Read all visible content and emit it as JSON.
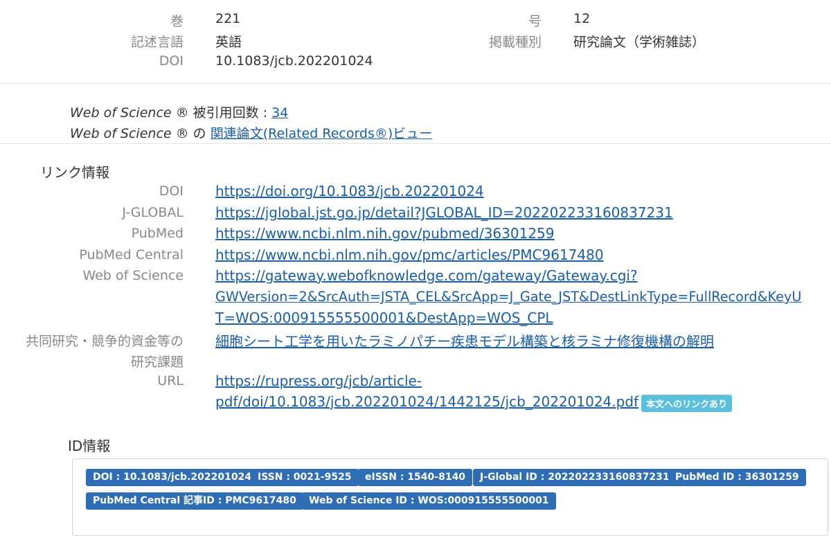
{
  "meta": {
    "volume_label": "巻",
    "volume_value": "221",
    "issue_label": "号",
    "issue_value": "12",
    "language_label": "記述言語",
    "language_value": "英語",
    "type_label": "掲載種別",
    "type_value": "研究論文（学術雑誌）",
    "doi_label": "DOI",
    "doi_value": "10.1083/jcb.202201024"
  },
  "wos": {
    "brand": "Web of Science",
    "reg": " ®",
    "cited_label": " 被引用回数 : ",
    "cited_count": "34",
    "no": " の ",
    "related_link": "関連論文(Related Records®)ビュー"
  },
  "links": {
    "title": "リンク情報",
    "doi_label": "DOI",
    "doi_url": "https://doi.org/10.1083/jcb.202201024",
    "jglobal_label": "J-GLOBAL",
    "jglobal_url": "https://jglobal.jst.go.jp/detail?JGLOBAL_ID=202202233160837231",
    "pubmed_label": "PubMed",
    "pubmed_url": "https://www.ncbi.nlm.nih.gov/pubmed/36301259",
    "pmc_label": "PubMed Central",
    "pmc_url": "https://www.ncbi.nlm.nih.gov/pmc/articles/PMC9617480",
    "wos_label": "Web of Science",
    "wos_url_line1": "https://gateway.webofknowledge.com/gateway/Gateway.cgi?",
    "wos_url_line2": "GWVersion=2&SrcAuth=JSTA_CEL&SrcApp=J_Gate_JST&DestLinkType=FullRecord&KeyU",
    "wos_url_line3": "T=WOS:000915555500001&DestApp=WOS_CPL",
    "grant_label_line1": "共同研究・競争的資金等の",
    "grant_label_line2": "研究課題",
    "grant_link": "細胞シート工学を用いたラミノパチー疾患モデル構築と核ラミナ修復機構の解明",
    "url_label": "URL",
    "url_line1": "https://rupress.org/jcb/article-",
    "url_line2": "pdf/doi/10.1083/jcb.202201024/1442125/jcb_202201024.pdf",
    "fulltext_badge": "本文へのリンクあり"
  },
  "ids": {
    "title": "ID情報",
    "tags": [
      "DOI : 10.1083/jcb.202201024",
      "ISSN : 0021-9525",
      "eISSN : 1540-8140",
      "J-Global ID : 202202233160837231",
      "PubMed ID : 36301259",
      "PubMed Central 記事ID : PMC9617480",
      "Web of Science ID : WOS:000915555500001"
    ]
  },
  "colors": {
    "link": "#1a5ea8",
    "badge_oa": "#5bc0de",
    "id_tag": "#2f6db5",
    "label": "#888888"
  }
}
